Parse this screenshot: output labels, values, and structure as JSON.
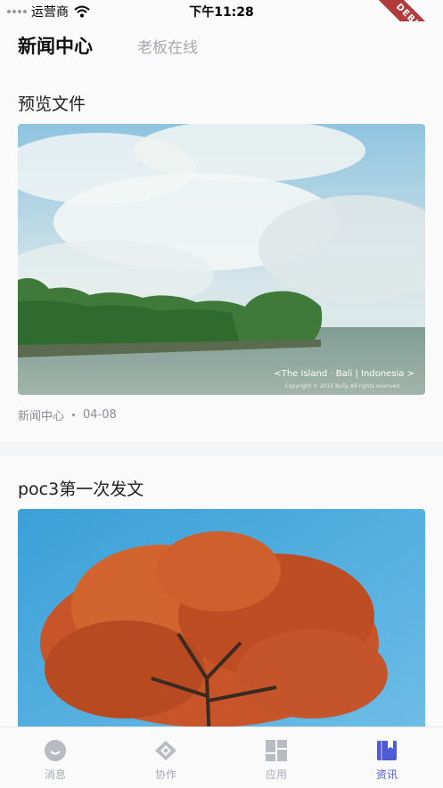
{
  "status_bar": {
    "carrier": "运营商",
    "time": "下午11:28"
  },
  "debug_banner": "DEBUG",
  "header": {
    "tabs": [
      {
        "label": "新闻中心",
        "active": true
      },
      {
        "label": "老板在线",
        "active": false
      }
    ]
  },
  "articles": [
    {
      "title": "预览文件",
      "source": "新闻中心",
      "date": "04-08",
      "image_caption": "<The Island · Bali | Indonesia >",
      "image_copyright": "Copyright © 2015 BuTy. All rights reserved."
    },
    {
      "title": "poc3第一次发文"
    }
  ],
  "tabbar": {
    "items": [
      {
        "label": "消息",
        "icon": "smile-icon",
        "active": false
      },
      {
        "label": "协作",
        "icon": "collaboration-icon",
        "active": false
      },
      {
        "label": "应用",
        "icon": "apps-grid-icon",
        "active": false
      },
      {
        "label": "资讯",
        "icon": "book-icon",
        "active": true
      }
    ],
    "colors": {
      "active": "#4f5bd5",
      "inactive": "#a8abb2"
    }
  }
}
